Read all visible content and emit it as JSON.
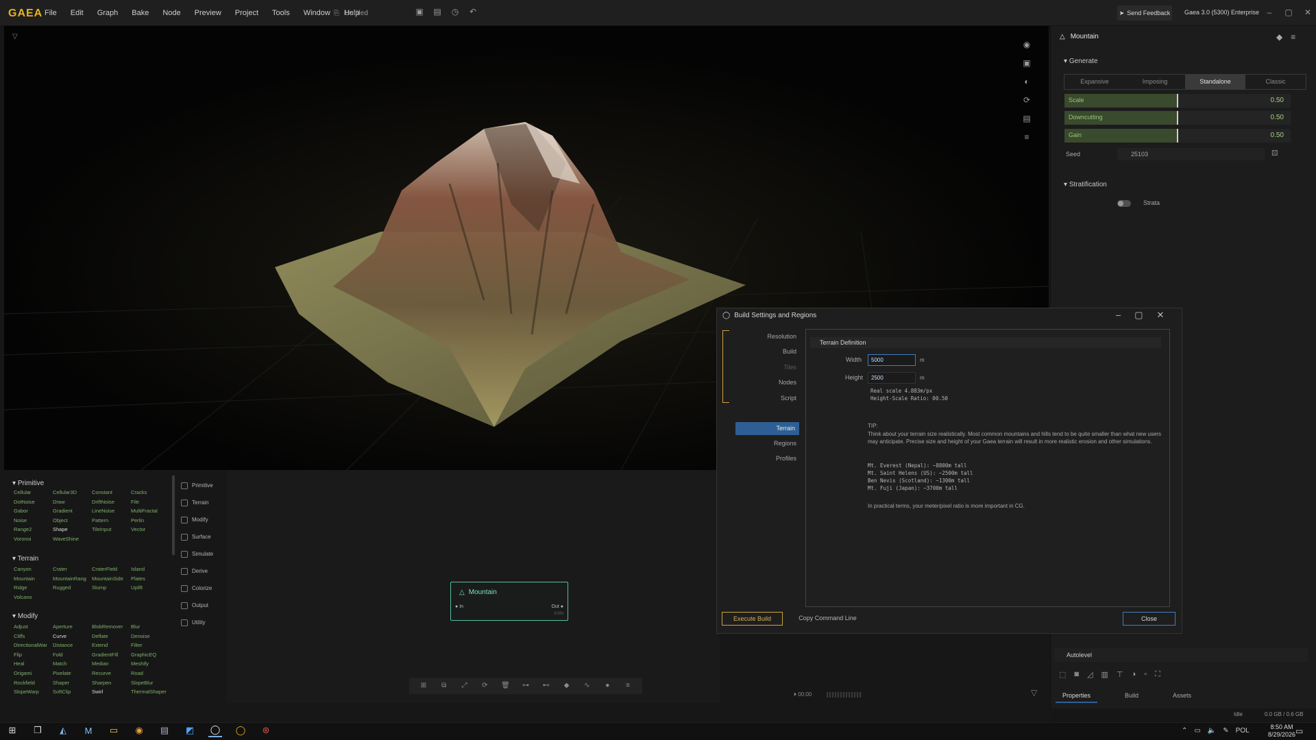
{
  "app": {
    "logo": "GAEA",
    "document": "Untitled",
    "feedback": "Send Feedback",
    "edition": "Gaea 3.0 (5300) Enterprise",
    "menu": [
      "File",
      "Edit",
      "Graph",
      "Bake",
      "Node",
      "Preview",
      "Project",
      "Tools",
      "Window",
      "Help"
    ]
  },
  "props": {
    "title": "Mountain",
    "generate": "Generate",
    "modes": [
      "Expansive",
      "Imposing",
      "Standalone",
      "Classic"
    ],
    "active_mode": "Standalone",
    "sliders": [
      {
        "label": "Scale",
        "value": "0.50",
        "fraction": 0.5
      },
      {
        "label": "Downcutting",
        "value": "0.50",
        "fraction": 0.5
      },
      {
        "label": "Gain",
        "value": "0.50",
        "fraction": 0.5
      }
    ],
    "seed_label": "Seed",
    "seed_value": "25103",
    "stratification": "Stratification",
    "strata": "Strata",
    "autolevel": "Autolevel",
    "tabs": [
      "Properties",
      "Build",
      "Assets"
    ],
    "status": "Idle",
    "memory": "0.0 GB / 0.6 GB"
  },
  "library": {
    "primitive": {
      "title": "Primitive",
      "items": [
        "Cellular",
        "Cellular3D",
        "Constant",
        "Cracks",
        "DotNoise",
        "Draw",
        "DriftNoise",
        "File",
        "Gabor",
        "Gradient",
        "LineNoise",
        "MultiFractal",
        "Noise",
        "Object",
        "Pattern",
        "Perlin",
        "Range2",
        "Shape",
        "TileInput",
        "Vector",
        "Voronoi",
        "WaveShine"
      ]
    },
    "terrain": {
      "title": "Terrain",
      "items": [
        "Canyon",
        "Crater",
        "CraterField",
        "Island",
        "Mountain",
        "MountainRang",
        "MountainSide",
        "Plates",
        "Ridge",
        "Rugged",
        "Slump",
        "Uplift",
        "Volcano"
      ]
    },
    "modify": {
      "title": "Modify",
      "items": [
        "Adjust",
        "Aperture",
        "BlobRemover",
        "Blur",
        "Cliffs",
        "Curve",
        "Deflate",
        "Denoise",
        "DirectionalWar",
        "Distance",
        "Extend",
        "Filter",
        "Flip",
        "Fold",
        "GradientFill",
        "GraphicEQ",
        "Heal",
        "Match",
        "Median",
        "Meshify",
        "Origami",
        "Pixelate",
        "Recurve",
        "Road",
        "Rockfield",
        "Shaper",
        "Sharpen",
        "SlopeBlur",
        "SlopeWarp",
        "SoftClip",
        "Swirl",
        "ThermalShaper"
      ]
    },
    "categories": [
      "Primitive",
      "Terrain",
      "Modify",
      "Surface",
      "Simulate",
      "Derive",
      "Colorize",
      "Output",
      "Utility"
    ]
  },
  "graph": {
    "node_title": "Mountain",
    "port_in": "In",
    "port_out": "Out",
    "node_footer": "0.0%",
    "zoom": "00:00"
  },
  "dialog": {
    "title": "Build Settings and Regions",
    "nav_top": [
      "Resolution",
      "Build",
      "Tiles",
      "Nodes",
      "Script"
    ],
    "nav_bottom": [
      "Terrain",
      "Regions",
      "Profiles"
    ],
    "active_nav": "Terrain",
    "section": "Terrain Definition",
    "width_label": "Width",
    "width_value": "5000",
    "height_label": "Height",
    "height_value": "2500",
    "unit": "m",
    "info1": "Real scale 4.883m/px",
    "info2": "Height-Scale Ratio: 00.50",
    "tip_head": "TIP:",
    "tip_body": "Think about your terrain size realistically. Most common mountains and hills tend to be quite smaller than what new users may anticipate. Precise size and height of your Gaea terrain will result in more realistic erosion and other simulations.",
    "examples": [
      "Mt. Everest (Nepal): ~8800m tall",
      "Mt. Saint Helens (US): ~2500m tall",
      "Ben Nevis (Scotland): ~1300m tall",
      "Mt. Fuji (Japan): ~3700m tall"
    ],
    "tip_tail": "In practical terms, your meter/pixel ratio is more important in CG.",
    "execute": "Execute Build",
    "copy": "Copy Command Line",
    "close": "Close"
  },
  "taskbar": {
    "language": "POL",
    "time": "8:50 AM",
    "date": "8/29/2026"
  },
  "colors": {
    "accent": "#e8b21e",
    "node_border": "#57bfa3",
    "slider_text": "#a7d27f",
    "active_blue": "#2e5f94"
  }
}
